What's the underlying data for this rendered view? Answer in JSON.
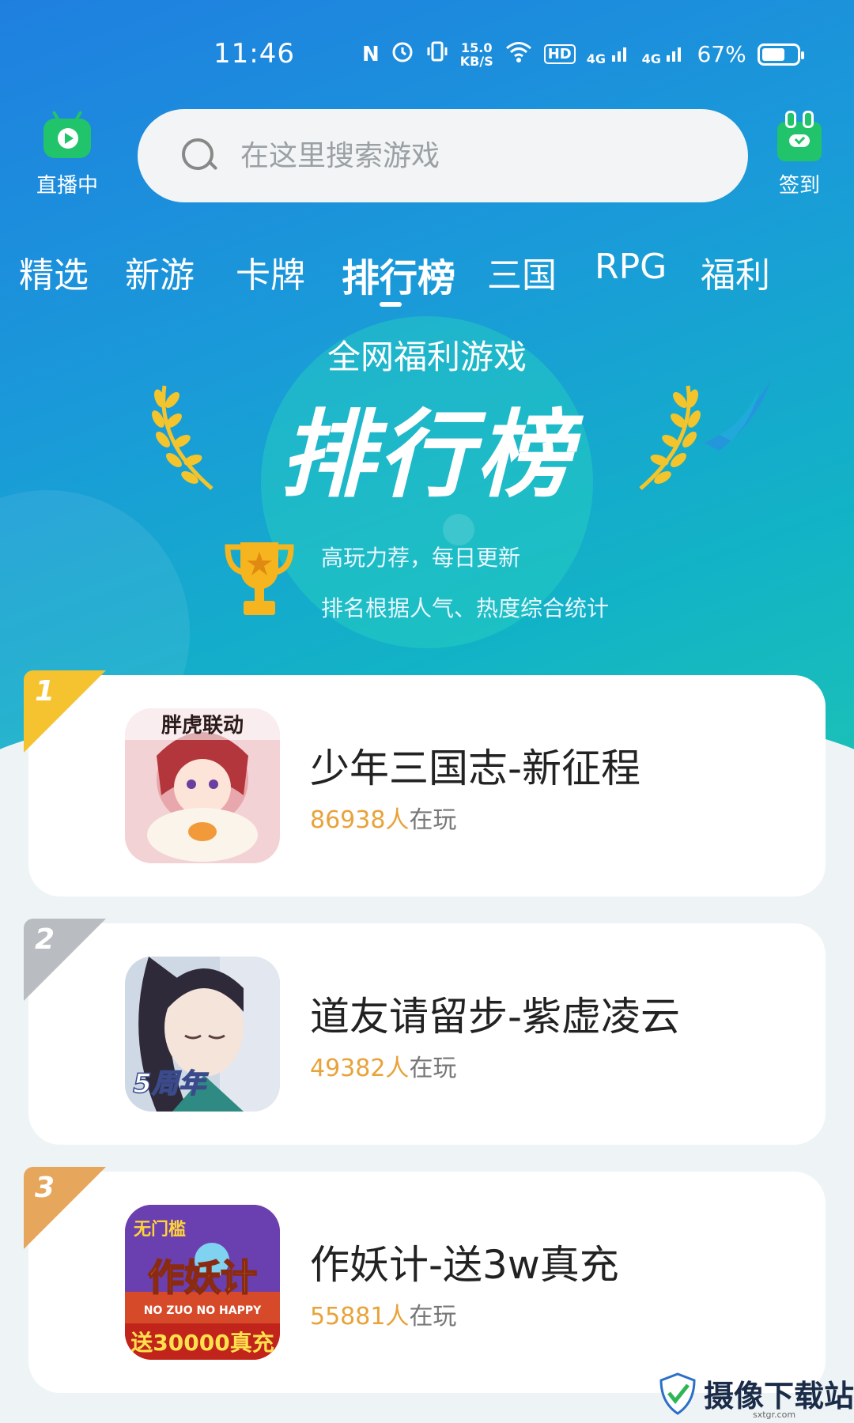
{
  "status_bar": {
    "time": "11:46",
    "nfc": "N",
    "speed_value": "15.0",
    "speed_unit": "KB/S",
    "hd": "HD",
    "sig1": "4G",
    "sig2": "4G",
    "battery_percent": "67%",
    "battery_level": 0.67
  },
  "header": {
    "live_label": "直播中",
    "search_placeholder": "在这里搜索游戏",
    "checkin_label": "签到"
  },
  "tabs": [
    {
      "label": "精选"
    },
    {
      "label": "新游"
    },
    {
      "label": "卡牌"
    },
    {
      "label": "排行榜",
      "active": true
    },
    {
      "label": "三国"
    },
    {
      "label": "RPG"
    },
    {
      "label": "福利"
    }
  ],
  "hero": {
    "subtitle": "全网福利游戏",
    "title": "排行榜",
    "desc1": "高玩力荐，每日更新",
    "desc2": "排名根据人气、热度综合统计"
  },
  "games": [
    {
      "rank": "1",
      "name": "少年三国志-新征程",
      "players": "86938人",
      "suffix": "在玩",
      "badge_color": "#f5c330",
      "badge_dark": "#c8961a",
      "icon_text": "胖虎联动"
    },
    {
      "rank": "2",
      "name": "道友请留步-紫虚凌云",
      "players": "49382人",
      "suffix": "在玩",
      "badge_color": "#b9bcc0",
      "badge_dark": "#8a8d91",
      "icon_text": "5周年"
    },
    {
      "rank": "3",
      "name": "作妖计-送3w真充",
      "players": "55881人",
      "suffix": "在玩",
      "badge_color": "#e6a65b",
      "badge_dark": "#b9772f",
      "icon_text": "作妖计",
      "icon_text2": "送30000真充",
      "icon_text3": "无门槛",
      "icon_text4": "NO ZUO NO HAPPY"
    }
  ],
  "watermark": {
    "text": "摄像下载站",
    "sub": "sxtgr.com"
  }
}
